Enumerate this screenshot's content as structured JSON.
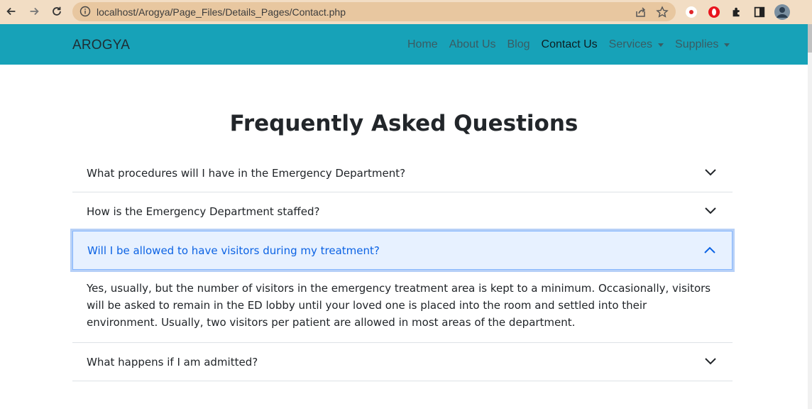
{
  "browser": {
    "url": "localhost/Arogya/Page_Files/Details_Pages/Contact.php",
    "icons": [
      "back-arrow-icon",
      "forward-arrow-icon",
      "reload-icon",
      "info-icon",
      "share-icon",
      "star-icon",
      "record-extension-icon",
      "opera-extension-icon",
      "puzzle-extension-icon",
      "sidebar-icon",
      "profile-avatar"
    ]
  },
  "navbar": {
    "brand": "AROGYA",
    "links": [
      {
        "label": "Home",
        "active": false,
        "dropdown": false
      },
      {
        "label": "About Us",
        "active": false,
        "dropdown": false
      },
      {
        "label": "Blog",
        "active": false,
        "dropdown": false
      },
      {
        "label": "Contact Us",
        "active": true,
        "dropdown": false
      },
      {
        "label": "Services",
        "active": false,
        "dropdown": true
      },
      {
        "label": "Supplies",
        "active": false,
        "dropdown": true
      }
    ],
    "color": "#17a2b8"
  },
  "faq": {
    "title": "Frequently Asked Questions",
    "items": [
      {
        "question": "What procedures will I have in the Emergency Department?",
        "expanded": false
      },
      {
        "question": "How is the Emergency Department staffed?",
        "expanded": false
      },
      {
        "question": "Will I be allowed to have visitors during my treatment?",
        "expanded": true,
        "answer": "Yes, usually, but the number of visitors in the emergency treatment area is kept to a minimum. Occasionally, visitors will be asked to remain in the ED lobby until your loved one is placed into the room and settled into their environment. Usually, two visitors per patient are allowed in most areas of the department."
      },
      {
        "question": "What happens if I am admitted?",
        "expanded": false
      }
    ]
  }
}
